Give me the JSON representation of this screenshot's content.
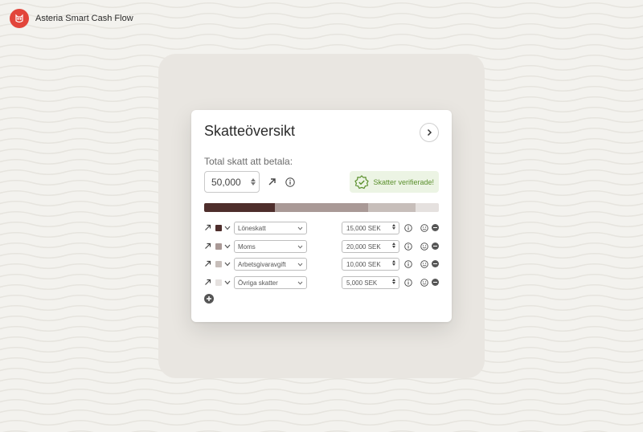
{
  "app": {
    "name": "Asteria Smart Cash Flow",
    "logo_icon": "owl-logo-icon",
    "logo_color": "#e2453b"
  },
  "card": {
    "title": "Skatteöversikt",
    "next_icon": "chevron-right-icon",
    "total_label": "Total skatt att betala:",
    "total_value": "50,000",
    "verified_label": "Skatter verifierade!",
    "verified_icon": "check-badge-icon"
  },
  "colors": {
    "accent_green": "#5a8f2c",
    "verified_bg": "#ecf4e4",
    "series": [
      "#4e2e2c",
      "#a99996",
      "#c7beba",
      "#e5e1df"
    ]
  },
  "tax_rows": [
    {
      "category": "Löneskatt",
      "amount": "15,000 SEK",
      "share": 0.3,
      "color": "#4e2e2c"
    },
    {
      "category": "Moms",
      "amount": "20,000 SEK",
      "share": 0.4,
      "color": "#a99996"
    },
    {
      "category": "Arbetsgivaravgift",
      "amount": "10,000 SEK",
      "share": 0.2,
      "color": "#c7beba"
    },
    {
      "category": "Övriga skatter",
      "amount": "5,000 SEK",
      "share": 0.1,
      "color": "#e5e1df"
    }
  ],
  "add_row_icon": "plus-circle-icon"
}
